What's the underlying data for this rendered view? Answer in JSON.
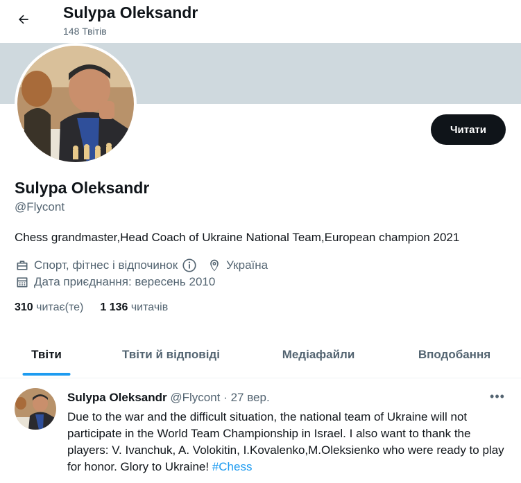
{
  "header": {
    "name": "Sulypa Oleksandr",
    "tweet_count": "148 Твітів"
  },
  "profile": {
    "name": "Sulypa Oleksandr",
    "handle": "@Flycont",
    "bio": "Chess grandmaster,Head Coach of Ukraine National Team,European champion 2021",
    "category": "Спорт, фітнес і відпочинок",
    "location": "Україна",
    "joined": "Дата приєднання: вересень 2010",
    "following_count": "310",
    "following_label": "читає(те)",
    "followers_count": "1 136",
    "followers_label": "читачів",
    "follow_button": "Читати"
  },
  "tabs": [
    {
      "label": "Твіти",
      "active": true
    },
    {
      "label": "Твіти й відповіді",
      "active": false
    },
    {
      "label": "Медіафайли",
      "active": false
    },
    {
      "label": "Вподобання",
      "active": false
    }
  ],
  "tweet": {
    "name": "Sulypa Oleksandr",
    "handle": "@Flycont",
    "separator": "·",
    "date": "27 вер.",
    "text": "Due to the war and the difficult situation, the national team of Ukraine will not participate in the World Team Championship in Israel. I also want to thank the players: V. Ivanchuk, A. Volokitin, I.Kovalenko,M.Oleksienko who were ready to play for honor. Glory to Ukraine!",
    "hashtag": "#Chess",
    "more": "•••"
  },
  "colors": {
    "accent": "#1d9bf0",
    "banner": "#cfd9de",
    "text_secondary": "#536471",
    "button_dark": "#0f1419"
  },
  "icons": {
    "back": "arrow-left-icon",
    "category": "briefcase-icon",
    "info": "info-icon",
    "location": "location-pin-icon",
    "calendar": "calendar-icon",
    "more": "more-horizontal-icon"
  }
}
